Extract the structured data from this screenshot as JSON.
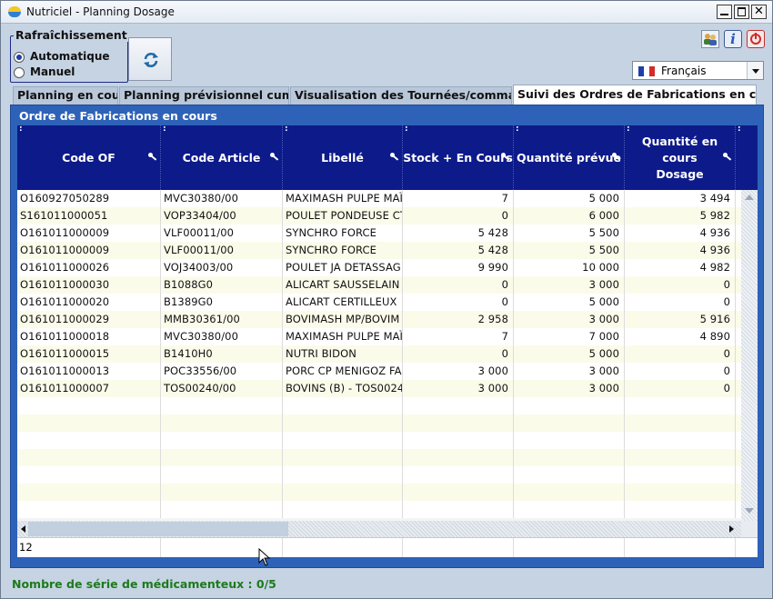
{
  "window": {
    "title": "Nutriciel - Planning Dosage"
  },
  "refresh": {
    "group_label": "Rafraîchissement",
    "options": [
      {
        "label": "Automatique",
        "selected": true
      },
      {
        "label": "Manuel",
        "selected": false
      }
    ]
  },
  "language": {
    "selected": "Français"
  },
  "tabs": [
    {
      "label": "Planning en cours",
      "active": false
    },
    {
      "label": "Planning prévisionnel cumulé",
      "active": false
    },
    {
      "label": "Visualisation des Tournées/commandes",
      "active": false
    },
    {
      "label": "Suivi des Ordres de Fabrications en cours",
      "active": true
    }
  ],
  "panel": {
    "title": "Ordre de Fabrications en cours"
  },
  "table": {
    "columns": [
      "Code OF",
      "Code Article",
      "Libellé",
      "Stock + En Cours",
      "Quantité prévue",
      "Quantité en cours Dosage"
    ],
    "rows": [
      [
        "O160927050289",
        "MVC30380/00",
        "MAXIMASH PULPE MAÏ",
        "7",
        "5 000",
        "3 494"
      ],
      [
        "S161011000051",
        "VOP33404/00",
        "POULET PONDEUSE CT",
        "0",
        "6 000",
        "5 982"
      ],
      [
        "O161011000009",
        "VLF00011/00",
        "SYNCHRO FORCE",
        "5 428",
        "5 500",
        "4 936"
      ],
      [
        "O161011000009",
        "VLF00011/00",
        "SYNCHRO FORCE",
        "5 428",
        "5 500",
        "4 936"
      ],
      [
        "O161011000026",
        "VOJ34003/00",
        "POULET JA DETASSAG",
        "9 990",
        "10 000",
        "4 982"
      ],
      [
        "O161011000030",
        "B1088G0",
        "ALICART SAUSSELAIN",
        "0",
        "3 000",
        "0"
      ],
      [
        "O161011000020",
        "B1389G0",
        "ALICART CERTILLEUX",
        "0",
        "5 000",
        "0"
      ],
      [
        "O161011000029",
        "MMB30361/00",
        "BOVIMASH MP/BOVIM",
        "2 958",
        "3 000",
        "5 916"
      ],
      [
        "O161011000018",
        "MVC30380/00",
        "MAXIMASH PULPE MAÏ",
        "7",
        "7 000",
        "4 890"
      ],
      [
        "O161011000015",
        "B1410H0",
        "NUTRI BIDON",
        "0",
        "5 000",
        "0"
      ],
      [
        "O161011000013",
        "POC33556/00",
        "PORC CP MENIGOZ FA",
        "3 000",
        "3 000",
        "0"
      ],
      [
        "O161011000007",
        "TOS00240/00",
        "BOVINS (B) - TOS0024",
        "3 000",
        "3 000",
        "0"
      ]
    ],
    "row_count": "12"
  },
  "status": {
    "text": "Nombre de série de médicamenteux : 0/5"
  },
  "colors": {
    "header_bg": "#0d1a8a",
    "panel_bg": "#2d62b8",
    "status_text": "#1c7a1c",
    "row_alt": "#fbfbea"
  }
}
